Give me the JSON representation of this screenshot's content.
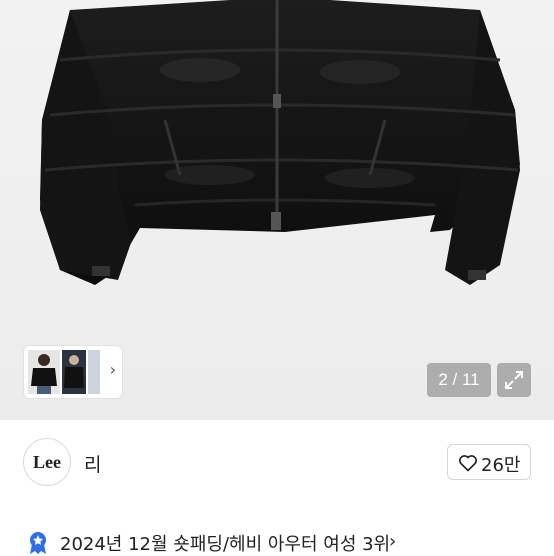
{
  "gallery": {
    "counter": "2 / 11",
    "current_index": 2,
    "total": 11,
    "thumbnails_more_icon": "chevron-right-icon",
    "expand_icon": "expand-icon"
  },
  "brand": {
    "logo_text": "Lee",
    "name": "리"
  },
  "like": {
    "icon": "heart-outline-icon",
    "count": "26만"
  },
  "ranking": {
    "icon": "rank-badge-icon",
    "text": "2024년 12월 숏패딩/헤비 아우터 여성 3위",
    "chevron": "›"
  },
  "colors": {
    "accent": "#2e6ee6",
    "text": "#222222",
    "border": "#d5d5d5"
  }
}
